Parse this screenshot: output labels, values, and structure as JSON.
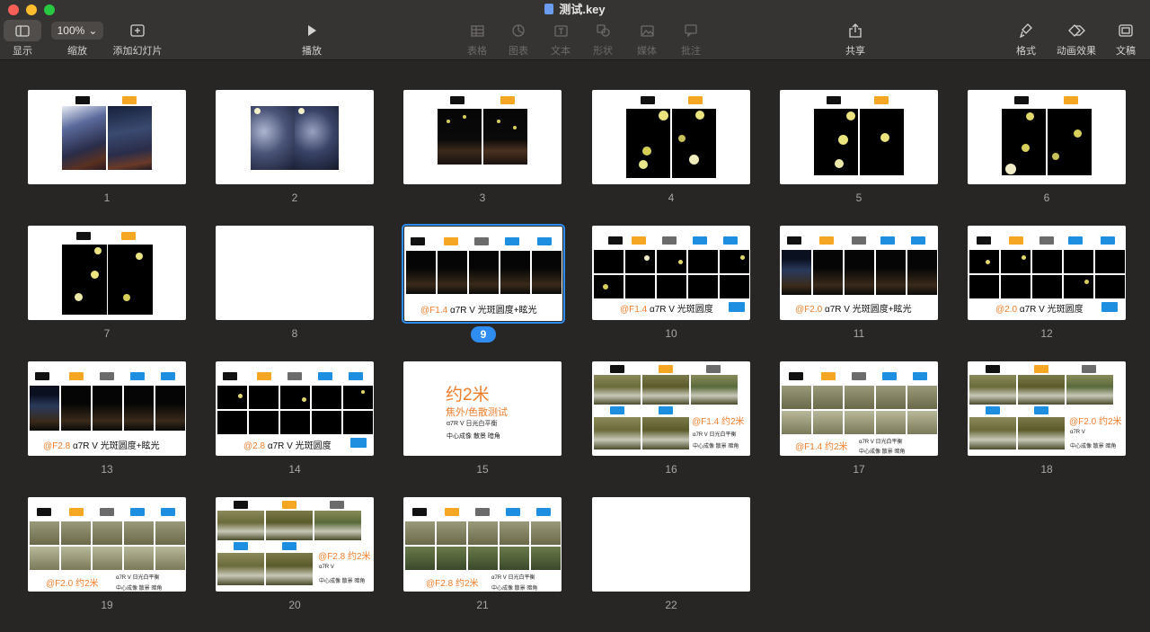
{
  "window": {
    "title": "测试.key"
  },
  "toolbar": {
    "view": "显示",
    "zoom_value": "100%",
    "zoom": "缩放",
    "add_slide": "添加幻灯片",
    "play": "播放",
    "table": "表格",
    "chart": "图表",
    "text": "文本",
    "shape": "形状",
    "media": "媒体",
    "comment": "批注",
    "share": "共享",
    "format": "格式",
    "animate": "动画效果",
    "document": "文稿"
  },
  "slides": {
    "s1": "1",
    "s2": "2",
    "s3": "3",
    "s4": "4",
    "s5": "5",
    "s6": "6",
    "s7": "7",
    "s8": "8",
    "s9": "9",
    "s10": "10",
    "s11": "11",
    "s12": "12",
    "s13": "13",
    "s14": "14",
    "s15": "15",
    "s16": "16",
    "s17": "17",
    "s18": "18",
    "s19": "19",
    "s20": "20",
    "s21": "21",
    "s22": "22"
  },
  "captions": {
    "c9_hl": "@F1.4",
    "c9": "α7R V 光斑圆度+眩光",
    "c10_hl": "@F1.4",
    "c10": "α7R V 光斑圆度",
    "c11_hl": "@F2.0",
    "c11": "α7R V 光斑圆度+眩光",
    "c12_hl": "@2.0",
    "c12": "α7R V 光斑圆度",
    "c13_hl": "@F2.8",
    "c13": "α7R V 光斑圆度+眩光",
    "c14_hl": "@2.8",
    "c14": "α7R V 光斑圆度",
    "s15_title": "约2米",
    "s15_sub": "焦外/色散测试",
    "s15_l1": "α7R V 日光白平衡",
    "s15_l2": "中心成像 散景 暗角",
    "c16_hl": "@F1.4 约2米",
    "c16_l1": "α7R V 日光白平衡",
    "c16_l2": "中心成像 散景 暗角",
    "c17_hl": "@F1.4 约2米",
    "c17_l1": "α7R V 日光白平衡",
    "c17_l2": "中心成像 散景 暗角",
    "c18_hl": "@F2.0 约2米",
    "c18_l1": "α7R V",
    "c18_l2": "中心成像 散景 暗角",
    "c19_hl": "@F2.0 约2米",
    "c19_l1": "α7R V 日光白平衡",
    "c19_l2": "中心成像 散景 暗角",
    "c20_hl": "@F2.8 约2米",
    "c20_l1": "α7R V",
    "c20_l2": "中心成像 散景 暗角",
    "c21_hl": "@F2.8 约2米",
    "c21_l1": "α7R V 日光白平衡",
    "c21_l2": "中心成像 散景 暗角"
  },
  "colors": {
    "accent": "#2f8cf0",
    "caption_highlight": "#f07d2a",
    "tag_black": "#111111",
    "tag_orange": "#f5a623",
    "tag_gray": "#6b6b6b",
    "tag_blue": "#1e8ee0"
  },
  "icons": [
    "sidebar-icon",
    "chevron-down-icon",
    "plus-square-icon",
    "play-icon",
    "table-icon",
    "chart-icon",
    "text-icon",
    "shape-icon",
    "media-icon",
    "comment-icon",
    "share-icon",
    "paintbrush-icon",
    "diamond-icon",
    "document-icon"
  ]
}
